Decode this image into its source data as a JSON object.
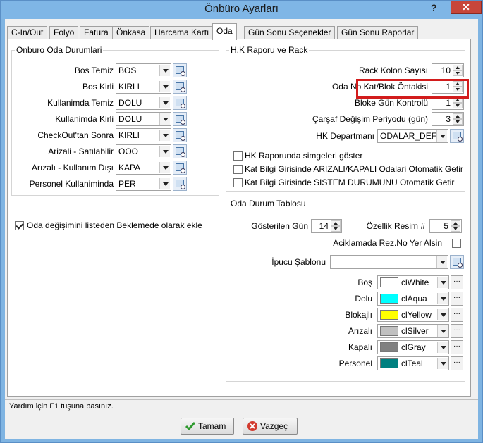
{
  "window": {
    "title": "Önbüro Ayarları",
    "help_glyph": "?",
    "close_glyph": "✕"
  },
  "tabs": [
    "C-In/Out",
    "Folyo",
    "Fatura",
    "Önkasa",
    "Harcama Kartı",
    "Oda",
    "Gün Sonu Seçenekler",
    "Gün Sonu Raporlar"
  ],
  "active_tab": "Oda",
  "room_status": {
    "legend": "Onburo Oda Durumlari",
    "rows": [
      {
        "label": "Bos Temiz",
        "value": "BOS"
      },
      {
        "label": "Bos Kirli",
        "value": "KIRLI"
      },
      {
        "label": "Kullanimda Temiz",
        "value": "DOLU"
      },
      {
        "label": "Kullanimda Kirli",
        "value": "DOLU"
      },
      {
        "label": "CheckOut'tan Sonra",
        "value": "KIRLI"
      },
      {
        "label": "Arizali - Satılabilir",
        "value": "OOO"
      },
      {
        "label": "Arızalı - Kullanım Dışı",
        "value": "KAPA"
      },
      {
        "label": "Personel Kullaniminda",
        "value": "PER"
      }
    ]
  },
  "room_change_checkbox": {
    "label": "Oda değişimini listeden Beklemede olarak ekle",
    "checked": true
  },
  "hk": {
    "legend": "H.K Raporu ve Rack",
    "rack_columns": {
      "label": "Rack Kolon Sayısı",
      "value": "10"
    },
    "prefix": {
      "label": "Oda No Kat/Blok Öntakisi",
      "value": "1"
    },
    "block_day": {
      "label": "Bloke Gün Kontrolü",
      "value": "1"
    },
    "sheet_period": {
      "label": "Çarşaf Değişim Periyodu (gün)",
      "value": "3"
    },
    "department": {
      "label": "HK Departmanı",
      "value": "ODALAR_DEF"
    },
    "checks": [
      {
        "label": "HK Raporunda simgeleri göster",
        "checked": false
      },
      {
        "label": "Kat Bilgi Girisinde ARIZALI/KAPALI Odalari Otomatik Getir",
        "checked": false
      },
      {
        "label": "Kat Bilgi Girisinde SISTEM DURUMUNU Otomatik Getir",
        "checked": false
      }
    ]
  },
  "room_table": {
    "legend": "Oda Durum Tablosu",
    "shown_days": {
      "label": "Gösterilen Gün",
      "value": "14"
    },
    "feature_image": {
      "label": "Özellik Resim #",
      "value": "5"
    },
    "rez_no": {
      "label": "Aciklamada Rez.No Yer Alsin",
      "checked": false
    },
    "tip_template": {
      "label": "İpucu Şablonu",
      "value": ""
    },
    "colors": [
      {
        "label": "Boş",
        "value": "clWhite",
        "color": "#ffffff"
      },
      {
        "label": "Dolu",
        "value": "clAqua",
        "color": "#00ffff"
      },
      {
        "label": "Blokajlı",
        "value": "clYellow",
        "color": "#ffff00"
      },
      {
        "label": "Arızalı",
        "value": "clSilver",
        "color": "#c0c0c0"
      },
      {
        "label": "Kapalı",
        "value": "clGray",
        "color": "#808080"
      },
      {
        "label": "Personel",
        "value": "clTeal",
        "color": "#008080"
      }
    ],
    "dots": "···"
  },
  "status_bar": "Yardım için F1 tuşuna basınız.",
  "buttons": {
    "ok": "Tamam",
    "cancel": "Vazgeç"
  }
}
